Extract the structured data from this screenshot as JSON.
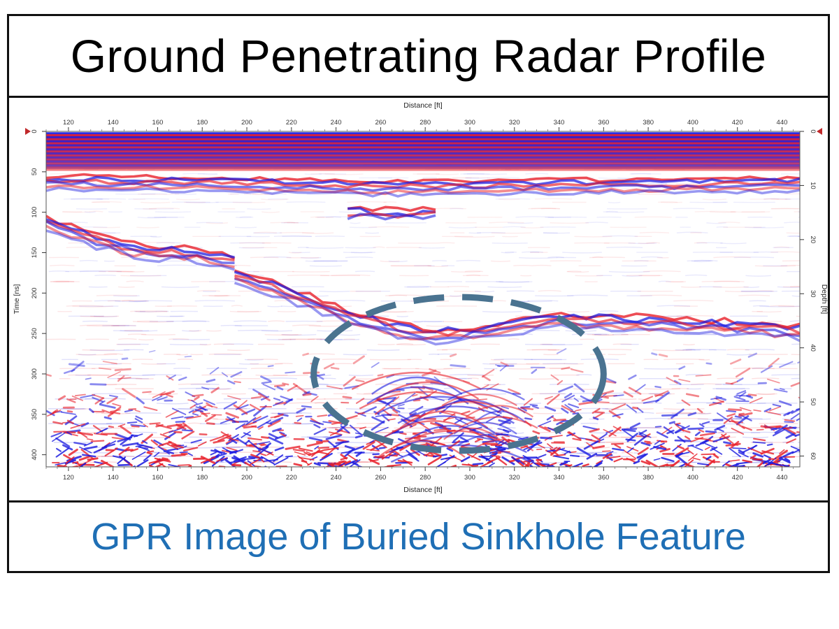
{
  "title": "Ground Penetrating Radar Profile",
  "caption": "GPR Image of Buried Sinkhole Feature",
  "colors": {
    "caption": "#1f6fb5",
    "positive": "#e8202a",
    "negative": "#1a1ae0",
    "annotation": "#4a7390",
    "marker": "#c0282a"
  },
  "chart_data": {
    "type": "heatmap",
    "xlabel": "Distance [ft]",
    "ylabel_left": "Time [ns]",
    "ylabel_right": "Depth [ft]",
    "xlim": [
      110,
      448
    ],
    "ylim_time": [
      0,
      415
    ],
    "ylim_depth": [
      0,
      62
    ],
    "x_ticks": [
      120,
      140,
      160,
      180,
      200,
      220,
      240,
      260,
      280,
      300,
      320,
      340,
      360,
      380,
      400,
      420,
      440
    ],
    "time_ticks": [
      0,
      50,
      100,
      150,
      200,
      250,
      300,
      350,
      400
    ],
    "depth_ticks": [
      0,
      10,
      20,
      30,
      40,
      50,
      60
    ],
    "annotation": {
      "shape": "dashed-ellipse",
      "center_distance": 295,
      "center_time": 300,
      "half_width_distance": 65,
      "half_height_time": 95
    },
    "reflectors": [
      {
        "name": "surface-bands",
        "points": [
          [
            110,
            5
          ],
          [
            448,
            5
          ]
        ]
      },
      {
        "name": "shallow-layer",
        "points": [
          [
            110,
            55
          ],
          [
            200,
            58
          ],
          [
            260,
            62
          ],
          [
            340,
            60
          ],
          [
            448,
            58
          ]
        ]
      },
      {
        "name": "upper-lens",
        "points": [
          [
            245,
            95
          ],
          [
            270,
            98
          ],
          [
            290,
            95
          ]
        ]
      },
      {
        "name": "left-layer",
        "points": [
          [
            110,
            105
          ],
          [
            130,
            125
          ],
          [
            150,
            140
          ],
          [
            180,
            145
          ],
          [
            200,
            160
          ]
        ]
      },
      {
        "name": "dipping-layer",
        "points": [
          [
            190,
            165
          ],
          [
            220,
            195
          ],
          [
            250,
            225
          ],
          [
            280,
            245
          ],
          [
            310,
            240
          ],
          [
            340,
            225
          ],
          [
            380,
            230
          ],
          [
            420,
            235
          ],
          [
            448,
            240
          ]
        ]
      }
    ]
  }
}
